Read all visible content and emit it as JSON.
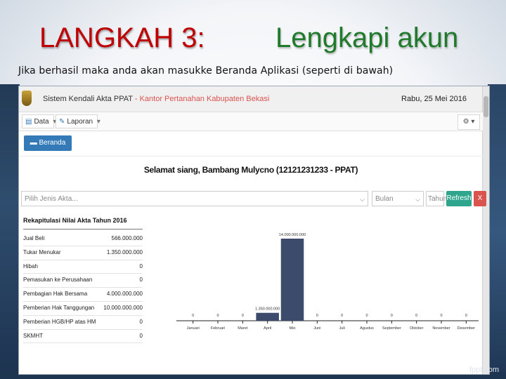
{
  "slide": {
    "title_part1": "LANGKAH 3:",
    "title_part2": "Lengkapi akun",
    "subtitle": "Jika berhasil maka anda akan masukke Beranda Aplikasi (seperti di bawah)"
  },
  "app": {
    "title": "Sistem Kendali Akta PPAT",
    "title_sub": "- Kantor Pertanahan Kabupaten Bekasi",
    "date": "Rabu, 25 Mei 2016",
    "nav": {
      "data_label": "Data",
      "laporan_label": "Laporan"
    },
    "beranda_label": "Beranda",
    "greeting": "Selamat siang, Bambang Mulycno (12121231233 - PPAT)",
    "filters": {
      "jenis_akta_placeholder": "Pilih Jenis Akta...",
      "bulan_placeholder": "Bulan",
      "tahun_placeholder": "Tahun",
      "refresh_label": "Refresh",
      "clear_label": "X"
    },
    "rekap": {
      "title": "Rekapitulasi Nilai Akta Tahun 2016",
      "rows": [
        {
          "label": "Jual Beli",
          "value": "566.000.000"
        },
        {
          "label": "Tukar Menukar",
          "value": "1.350.000.000"
        },
        {
          "label": "Hibah",
          "value": "0"
        },
        {
          "label": "Pemasukan ke Perusahaan",
          "value": "0"
        },
        {
          "label": "Pembagian Hak Bersama",
          "value": "4.000.000.000"
        },
        {
          "label": "Pemberian Hak Tanggungan",
          "value": "10.000.000.000"
        },
        {
          "label": "Pemberian HGB/HP atas HM",
          "value": "0"
        },
        {
          "label": "SKMHT",
          "value": "0"
        }
      ]
    }
  },
  "chart_data": {
    "type": "bar",
    "categories": [
      "Januari",
      "Februari",
      "Maret",
      "April",
      "Mei",
      "Juni",
      "Juli",
      "Agustus",
      "September",
      "Oktober",
      "November",
      "Desember"
    ],
    "values": [
      0,
      0,
      0,
      1350000000,
      14000000000,
      0,
      0,
      0,
      0,
      0,
      0,
      0
    ],
    "value_labels": [
      "0",
      "0",
      "0",
      "1.350.000.000",
      "14.000.000.000",
      "0",
      "0",
      "0",
      "0",
      "0",
      "0",
      "0"
    ],
    "ylim": [
      0,
      14000000000
    ],
    "bar_color": "#3c4a6b",
    "grid": false
  },
  "footer": {
    "watermark": "fppt.com"
  }
}
